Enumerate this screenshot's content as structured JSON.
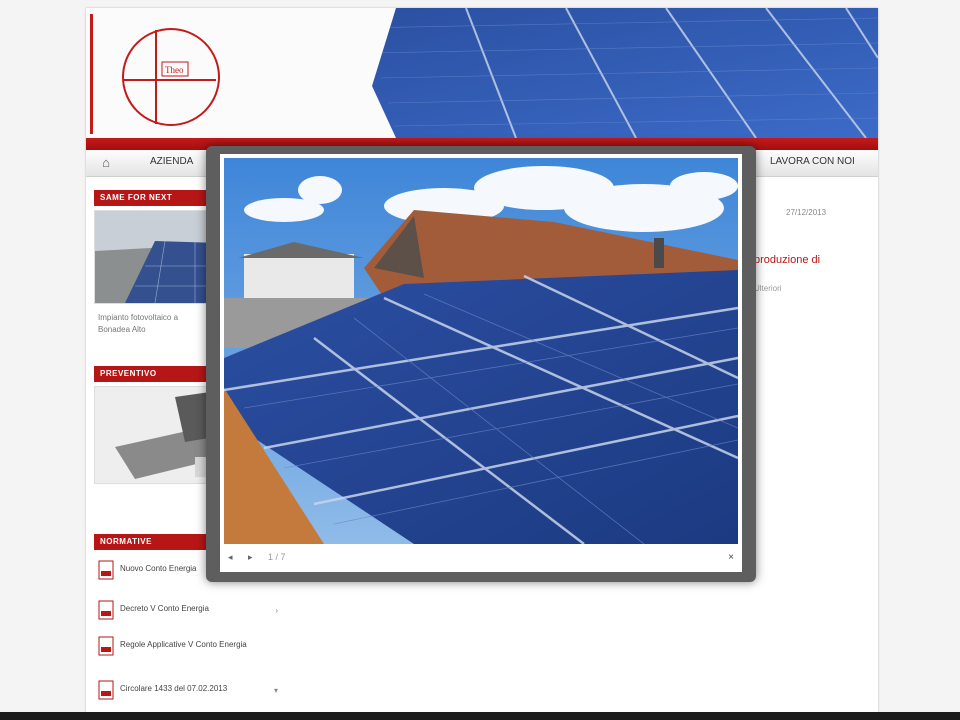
{
  "header": {
    "logo_text": "Theo",
    "accent_color": "#c31a1a"
  },
  "nav": {
    "home_icon": "home-icon",
    "home_label": "AZIENDA",
    "right_label": "LAVORA CON NOI"
  },
  "sidebar": {
    "box1_title": "SAME FOR NEXT",
    "box1_caption_line1": "Impianto fotovoltaico a",
    "box1_caption_line2": "Bonadea Alto",
    "box2_title": "PREVENTIVO",
    "box3_title": "NORMATIVE",
    "pdfs": [
      {
        "label": "Nuovo Conto Energia"
      },
      {
        "label": "Decreto V Conto Energia"
      },
      {
        "label": "Regole Applicative V Conto Energia"
      },
      {
        "label": "Circolare 1433 del 07.02.2013"
      }
    ]
  },
  "content": {
    "date": "27/12/2013",
    "heading": "produzione di",
    "subtext": "Ulteriori"
  },
  "modal": {
    "prev_label": "◂",
    "next_label": "▸",
    "counter": "1 / 7",
    "close_label": "×"
  }
}
